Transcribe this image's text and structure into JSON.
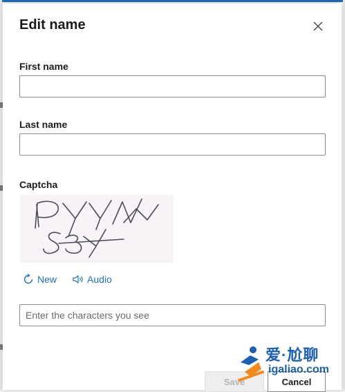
{
  "dialog": {
    "title": "Edit name",
    "close_icon": "close-icon"
  },
  "first_name": {
    "label": "First name",
    "value": "",
    "placeholder": ""
  },
  "last_name": {
    "label": "Last name",
    "value": "",
    "placeholder": ""
  },
  "captcha": {
    "label": "Captcha",
    "image_text": "PYYN S3Y",
    "new_label": "New",
    "new_icon": "refresh-icon",
    "audio_label": "Audio",
    "audio_icon": "speaker-icon",
    "input_value": "",
    "input_placeholder": "Enter the characters you see"
  },
  "buttons": {
    "save_label": "Save",
    "cancel_label": "Cancel"
  },
  "watermark": {
    "line1": "爱·尬聊",
    "line2": "igaliao.com"
  },
  "colors": {
    "link": "#1f6fc5",
    "accent_top": "#1e67b6",
    "watermark": "#1a5fb4"
  }
}
